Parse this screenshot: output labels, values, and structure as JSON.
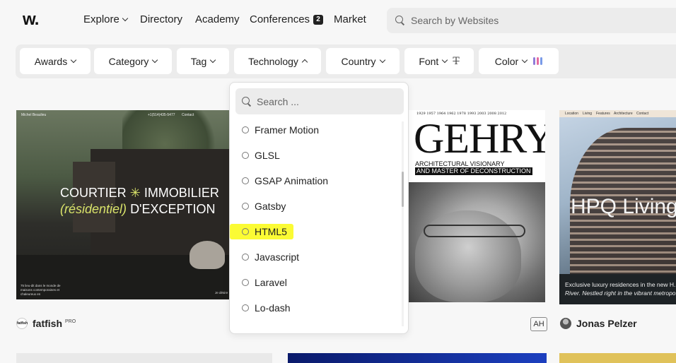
{
  "header": {
    "logo": "w.",
    "nav": [
      {
        "label": "Explore",
        "dropdown": true
      },
      {
        "label": "Directory"
      },
      {
        "label": "Academy"
      },
      {
        "label": "Conferences",
        "badge": "2"
      },
      {
        "label": "Market"
      }
    ],
    "search_placeholder": "Search by Websites"
  },
  "filters": [
    {
      "label": "Awards"
    },
    {
      "label": "Category"
    },
    {
      "label": "Tag"
    },
    {
      "label": "Technology",
      "open": true
    },
    {
      "label": "Country"
    },
    {
      "label": "Font"
    },
    {
      "label": "Color",
      "swatches": [
        "#8f7bd8",
        "#e56aa0",
        "#7a9be8"
      ]
    }
  ],
  "dropdown": {
    "search_placeholder": "Search ...",
    "items": [
      "Framer Motion",
      "GLSL",
      "GSAP Animation",
      "Gatsby",
      "HTML5",
      "Javascript",
      "Laravel",
      "Lo-dash"
    ],
    "highlighted": "HTML5",
    "highlight_color": "#fbfb34"
  },
  "cards": {
    "card1": {
      "nav_left": "Michel Beaulieu",
      "nav_mid": "+1(514)435-5477",
      "nav_right": "Contact",
      "headline_1": "COURTIER",
      "headline_star": "✳",
      "headline_2": "IMMOBILIER",
      "headline_accent": "(résidentiel)",
      "headline_3": "D'EXCEPTION",
      "foot_left": "75 lieu-dit dans le monde de maisons contemporaines et chaleureux en",
      "foot_right": "Je désire",
      "author": "fatfish",
      "avatar_text": "fatfish",
      "pro": "PRO"
    },
    "card2": {
      "years": "1929  1957  1964  1962  1978  1993  2003  2008  2012",
      "title": "GEHRY",
      "subtitle_1": "ARCHITECTURAL VISIONARY",
      "subtitle_2": "AND MASTER OF DECONSTRUCTION",
      "badge": "AH"
    },
    "card3": {
      "nav": [
        "Location",
        "Living",
        "Features",
        "Architecture",
        "Contact"
      ],
      "title": "HPQ Living",
      "caption_1": "Exclusive luxury residences in the new H...",
      "caption_2": "River. Nestled right in the vibrant metropo...",
      "author": "Jonas Pelzer"
    }
  }
}
